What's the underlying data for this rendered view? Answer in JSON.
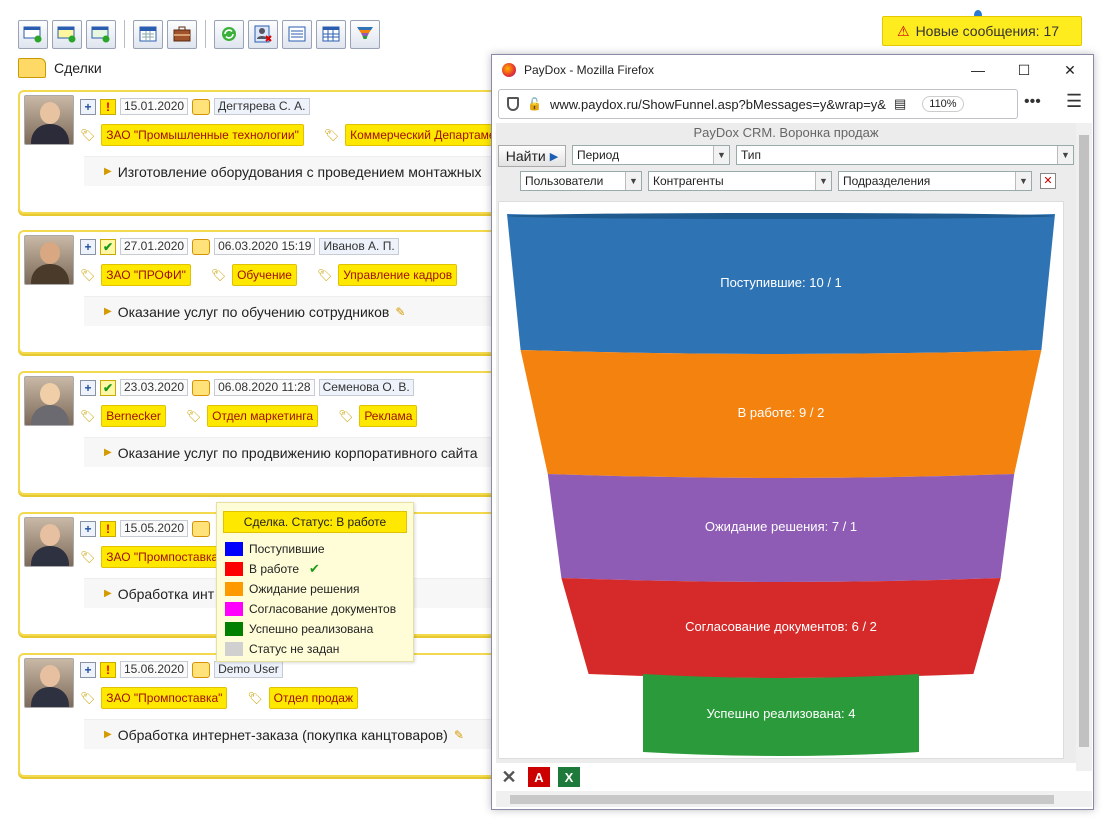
{
  "toolbar": {
    "buttons": [
      "new-card-icon",
      "new-card-yellow-icon",
      "new-card-green-icon",
      "calendar-icon",
      "briefcase-icon",
      "refresh-icon",
      "user-delete-icon",
      "list-icon",
      "grid-icon",
      "funnel-icon"
    ]
  },
  "messages": {
    "label": "Новые сообщения: 17"
  },
  "breadcrumb": {
    "label": "Сделки"
  },
  "deals": [
    {
      "date": "15.01.2020",
      "person": "Дегтярева С. А.",
      "tags": [
        "ЗАО \"Промышленные технологии\"",
        "Коммерческий Департамент"
      ],
      "title": "Изготовление оборудования с проведением монтажных",
      "status": "excl"
    },
    {
      "date": "27.01.2020",
      "date2": "06.03.2020 15:19",
      "person": "Иванов А. П.",
      "tags": [
        "ЗАО \"ПРОФИ\"",
        "Обучение",
        "Управление кадров"
      ],
      "title": "Оказание услуг по обучению сотрудников",
      "status": "check"
    },
    {
      "date": "23.03.2020",
      "date2": "06.08.2020 11:28",
      "person": "Семенова О. В.",
      "tags": [
        "Bernecker",
        "Отдел маркетинга",
        "Реклама"
      ],
      "title": "Оказание услуг по продвижению корпоративного сайта",
      "status": "check"
    },
    {
      "date": "15.05.2020",
      "person": "",
      "tags": [
        "ЗАО \"Промпоставка\""
      ],
      "title": "Обработка инт",
      "title_tail": ")",
      "status": "excl"
    },
    {
      "date": "15.06.2020",
      "person": "Demo User",
      "tags": [
        "ЗАО \"Промпоставка\"",
        "Отдел продаж"
      ],
      "title": "Обработка интернет-заказа (покупка канцтоваров)",
      "status": "excl"
    }
  ],
  "legend": {
    "header": "Сделка. Статус: В работе",
    "items": [
      {
        "label": "Поступившие",
        "color": "#0000ff"
      },
      {
        "label": "В работе",
        "color": "#ff0000",
        "checked": true
      },
      {
        "label": "Ожидание решения",
        "color": "#ff9900"
      },
      {
        "label": "Согласование документов",
        "color": "#ff00ff"
      },
      {
        "label": "Успешно реализована",
        "color": "#007f00"
      },
      {
        "label": "Статус не задан",
        "color": "#d0d0d0"
      }
    ]
  },
  "browser": {
    "title": "PayDox - Mozilla Firefox",
    "url": "www.paydox.ru/ShowFunnel.asp?bMessages=y&wrap=y&",
    "zoom": "110%",
    "page_title": "PayDox CRM. Воронка продаж",
    "find_label": "Найти",
    "filters": {
      "period": "Период",
      "type": "Тип",
      "users": "Пользователи",
      "contractors": "Контрагенты",
      "departments": "Подразделения"
    }
  },
  "chart_data": {
    "type": "funnel",
    "stages": [
      {
        "label": "Поступившие: 10 / 1",
        "name": "Поступившие",
        "value": 10,
        "secondary": 1,
        "color": "#2e74b5"
      },
      {
        "label": "В работе: 9 / 2",
        "name": "В работе",
        "value": 9,
        "secondary": 2,
        "color": "#f4820f"
      },
      {
        "label": "Ожидание решения: 7 / 1",
        "name": "Ожидание решения",
        "value": 7,
        "secondary": 1,
        "color": "#8e5cb5"
      },
      {
        "label": "Согласование документов: 6 / 2",
        "name": "Согласование документов",
        "value": 6,
        "secondary": 2,
        "color": "#d62a2a"
      },
      {
        "label": "Успешно реализована: 4",
        "name": "Успешно реализована",
        "value": 4,
        "color": "#2a9a3a"
      }
    ]
  }
}
